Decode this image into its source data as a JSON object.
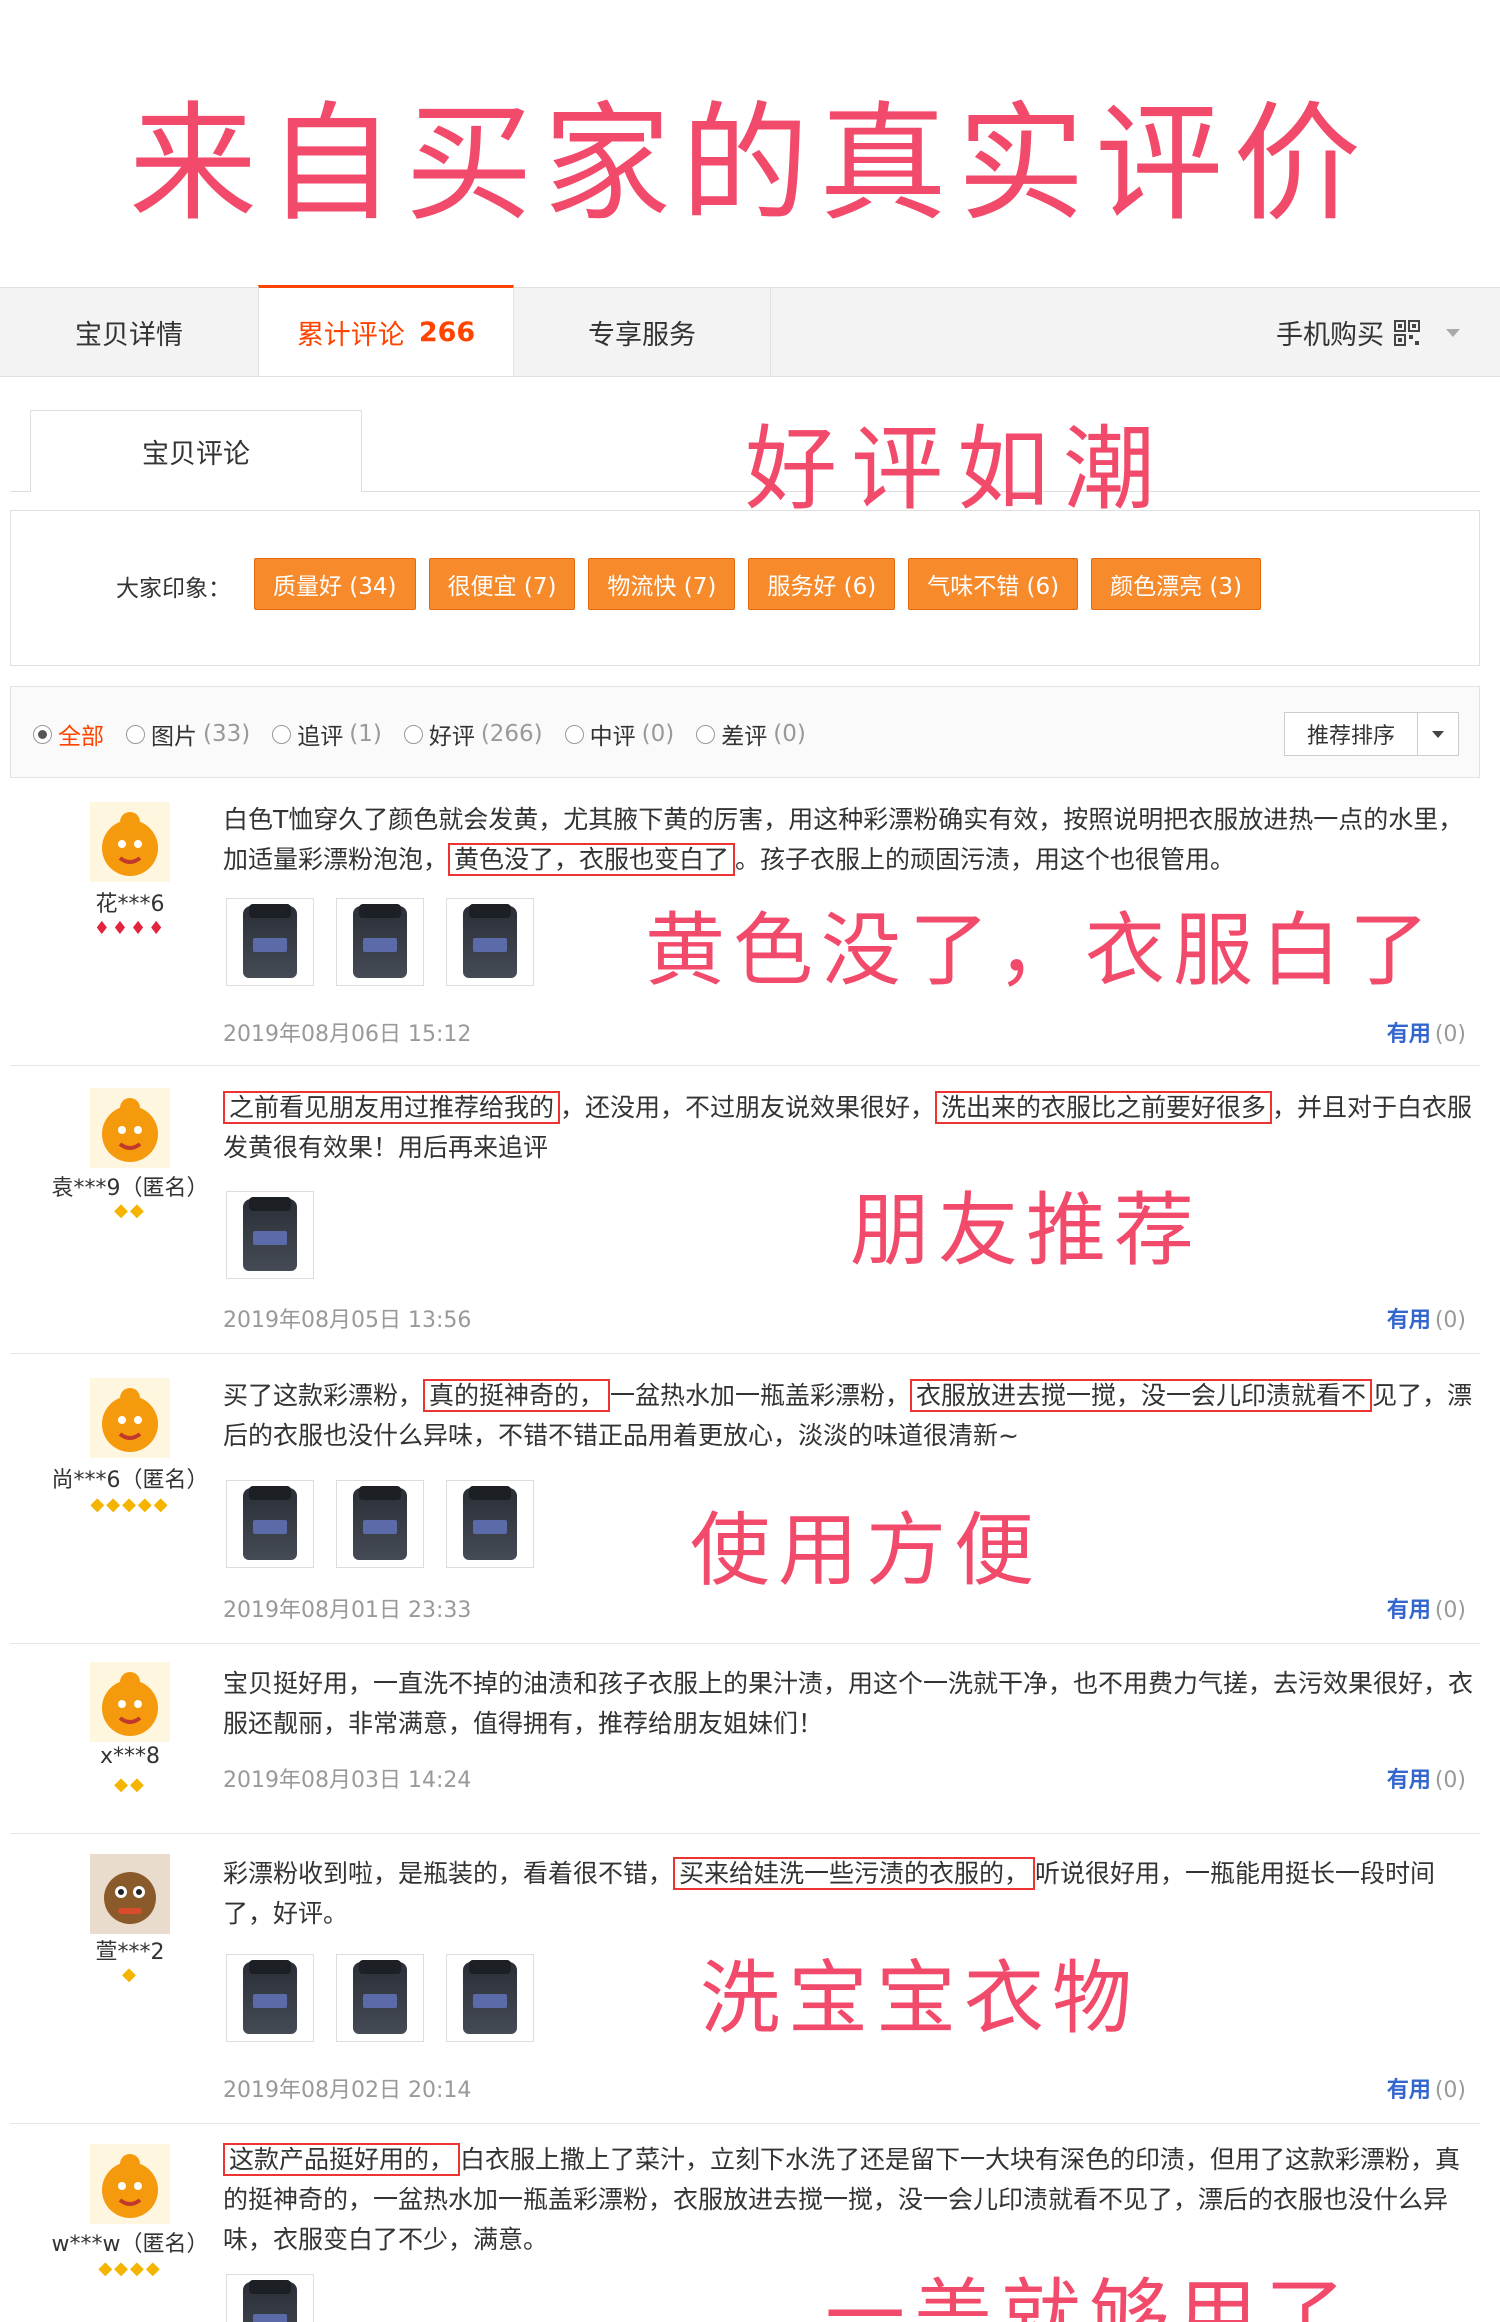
{
  "banner": {
    "title": "来自买家的真实评价"
  },
  "tabs": {
    "detail": "宝贝详情",
    "reviews": "累计评论",
    "reviews_count": "266",
    "service": "专享服务",
    "mobile": "手机购买"
  },
  "subtab": {
    "label": "宝贝评论"
  },
  "slogans": {
    "s1": "好评如潮",
    "s2": "黄色没了，衣服白了",
    "s3": "朋友推荐",
    "s4": "使用方便",
    "s5": "洗宝宝衣物",
    "s6": "一盖就够用了"
  },
  "impressions": {
    "label": "大家印象：",
    "tags": [
      "质量好 (34)",
      "很便宜 (7)",
      "物流快 (7)",
      "服务好 (6)",
      "气味不错 (6)",
      "颜色漂亮 (3)"
    ]
  },
  "filters": {
    "all": "全部",
    "pics": "图片",
    "pics_n": "(33)",
    "follow": "追评",
    "follow_n": "(1)",
    "good": "好评",
    "good_n": "(266)",
    "mid": "中评",
    "mid_n": "(0)",
    "bad": "差评",
    "bad_n": "(0)",
    "sort": "推荐排序"
  },
  "useful_label": "有用",
  "useful_count": "(0)",
  "reviews": [
    {
      "user": "花***6",
      "rank": "♦♦♦♦",
      "t1": "白色T恤穿久了颜色就会发黄，尤其腋下黄的厉害，用这种彩漂粉确实有效，按照说明把衣服放进热一点的水里，加适量彩漂粉泡泡，",
      "h1": "黄色没了，衣服也变白了",
      "t2": "。孩子衣服上的顽固污渍，用这个也很管用。",
      "date": "2019年08月06日 15:12"
    },
    {
      "user": "袁***9（匿名）",
      "rank": "◆◆",
      "h1": "之前看见朋友用过推荐给我的",
      "t1": "，还没用，不过朋友说效果很好，",
      "h2": "洗出来的衣服比之前要好很多",
      "t2": "，并且对于白衣服发黄很有效果！用后再来追评",
      "date": "2019年08月05日 13:56"
    },
    {
      "user": "尚***6（匿名）",
      "rank": "◆◆◆◆◆",
      "t1": "买了这款彩漂粉，",
      "h1": "真的挺神奇的，",
      "t2": "一盆热水加一瓶盖彩漂粉，",
      "h2": "衣服放进去搅一搅，没一会儿印渍就看不",
      "t3": "见了，漂后的衣服也没什么异味，不错不错正品用着更放心，淡淡的味道很清新~",
      "date": "2019年08月01日 23:33"
    },
    {
      "user": "x***8",
      "rank": "◆◆",
      "t1": "宝贝挺好用，一直洗不掉的油渍和孩子衣服上的果汁渍，用这个一洗就干净，也不用费力气搓，去污效果很好，衣服还靓丽，非常满意，值得拥有，推荐给朋友姐妹们！",
      "date": "2019年08月03日 14:24"
    },
    {
      "user": "萱***2",
      "rank": "◆",
      "t1": "彩漂粉收到啦，是瓶装的，看着很不错，",
      "h1": "买来给娃洗一些污渍的衣服的，",
      "t2": "听说很好用，一瓶能用挺长一段时间了，好评。",
      "date": "2019年08月02日 20:14"
    },
    {
      "user": "w***w（匿名）",
      "rank": "◆◆◆◆",
      "h1": "这款产品挺好用的，",
      "t1": "白衣服上撒上了菜汁，立刻下水洗了还是留下一大块有深色的印渍，但用了这款彩漂粉，真的挺神奇的，一盆热水加一瓶盖彩漂粉，衣服放进去搅一搅，没一会儿印渍就看不见了，漂后的衣服也没什么异味，衣服变白了不少，满意。"
    }
  ],
  "colors": {
    "accent": "#f40",
    "tag": "#f78b2c",
    "slogan": "#f24a6a",
    "link": "#36c"
  }
}
